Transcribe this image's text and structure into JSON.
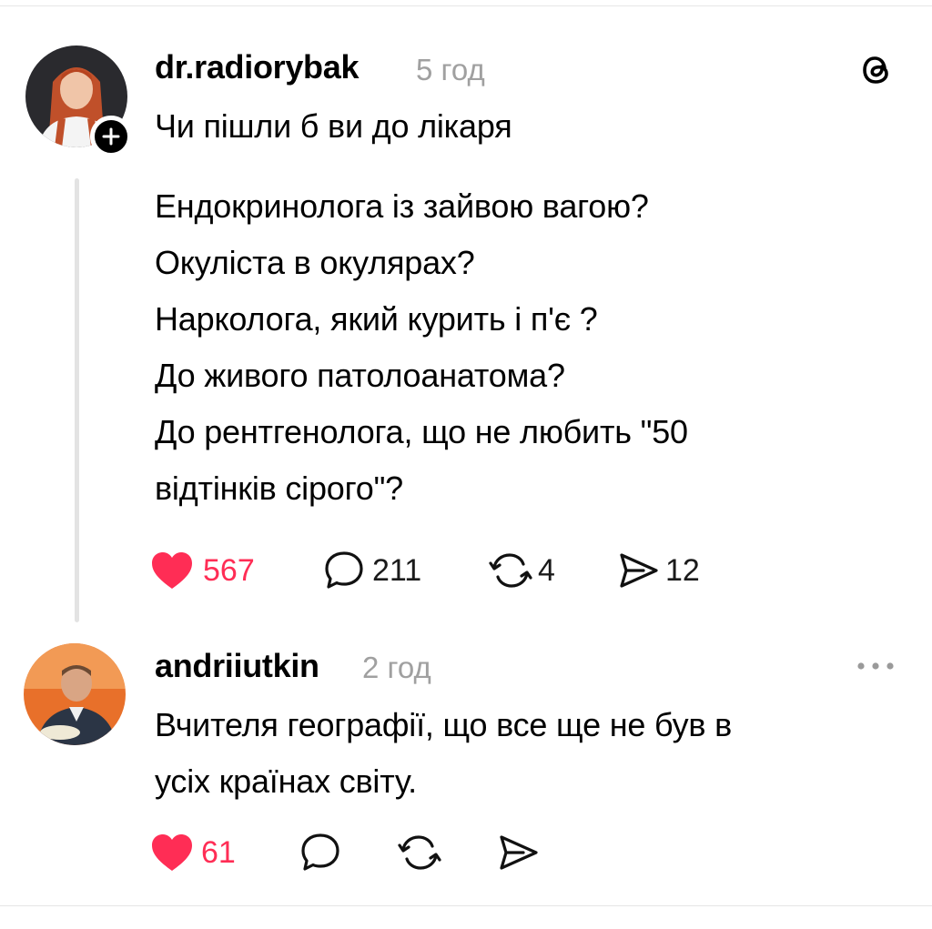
{
  "post": {
    "username": "dr.radiorybak",
    "time": "5 год",
    "title_line": "Чи пішли б ви до лікаря",
    "lines": [
      "Ендокринолога із зайвою вагою?",
      "Окуліста в окулярах?",
      "Нарколога, який курить і п'є ?",
      "До живого патолоанатома?",
      "До рентгенолога, що не любить \"50",
      "відтінків сірого\"?"
    ],
    "likes": "567",
    "comments": "211",
    "reposts": "4",
    "shares": "12"
  },
  "reply": {
    "username": "andriiutkin",
    "time": "2 год",
    "lines": [
      "Вчителя географії, що все ще не був в",
      "усіх країнах світу."
    ],
    "likes": "61"
  },
  "colors": {
    "like": "#ff2d55",
    "muted": "#a0a0a0",
    "thread_line": "#e3e3e3"
  },
  "icons": [
    "threads-logo-icon",
    "follow-plus-icon",
    "heart-icon",
    "comment-icon",
    "repost-icon",
    "share-icon",
    "more-icon"
  ]
}
